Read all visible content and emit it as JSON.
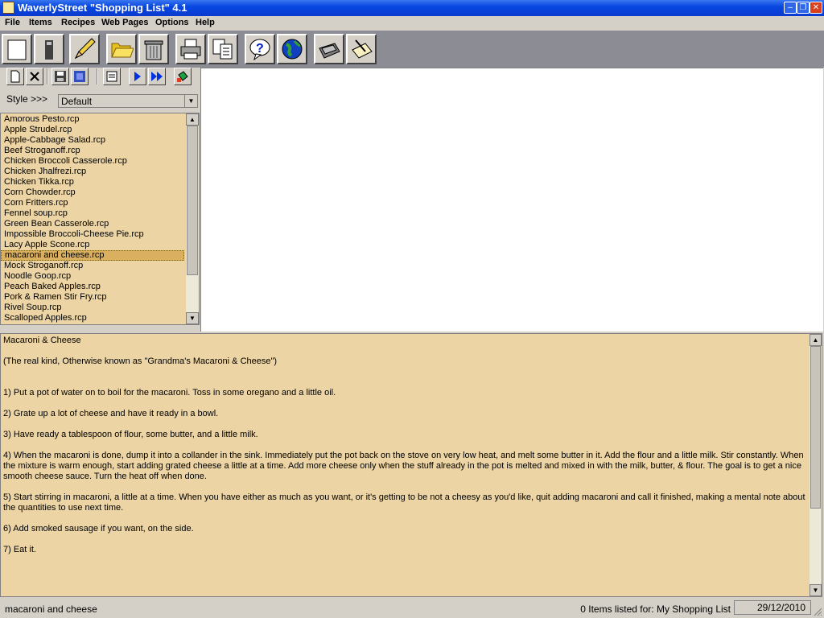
{
  "window": {
    "title": "WaverlyStreet \"Shopping List\" 4.1"
  },
  "menu": [
    "File",
    "Items",
    "Recipes",
    "Web Pages",
    "Options",
    "Help"
  ],
  "toolbar": {
    "large_icons": [
      "new-list-icon",
      "phone-icon",
      "pencil-icon",
      "folder-icon",
      "trash-can-icon",
      "printer-icon",
      "copy-pages-icon",
      "help-icon",
      "globe-icon",
      "fax-icon",
      "notepad-icon"
    ],
    "small_icons": [
      "new-page-icon",
      "delete-x-icon",
      "save-disk-icon",
      "save-list-icon",
      "notes-icon",
      "play-icon",
      "fast-forward-icon",
      "paint-bucket-icon"
    ]
  },
  "style": {
    "label": "Style >>>",
    "value": "Default"
  },
  "recipes": {
    "items": [
      "Amorous Pesto.rcp",
      "Apple Strudel.rcp",
      "Apple-Cabbage Salad.rcp",
      "Beef Stroganoff.rcp",
      "Chicken Broccoli Casserole.rcp",
      "Chicken Jhalfrezi.rcp",
      "Chicken Tikka.rcp",
      "Corn Chowder.rcp",
      "Corn Fritters.rcp",
      "Fennel soup.rcp",
      "Green Bean Casserole.rcp",
      "Impossible Broccoli-Cheese Pie.rcp",
      "Lacy Apple Scone.rcp",
      "macaroni and cheese.rcp",
      "Mock Stroganoff.rcp",
      "Noodle Goop.rcp",
      "Peach Baked Apples.rcp",
      "Pork & Ramen Stir Fry.rcp",
      "Rivel Soup.rcp",
      "Scalloped Apples.rcp"
    ],
    "selected": "macaroni and cheese.rcp"
  },
  "recipe_text": [
    "Macaroni & Cheese",
    "",
    "(The real kind, Otherwise known as \"Grandma's Macaroni & Cheese\")",
    "",
    "",
    "1) Put a pot of water on to boil for the macaroni. Toss in some oregano and a little oil.",
    "",
    "2) Grate up a lot of cheese and have it ready in a bowl.",
    "",
    "3) Have ready a tablespoon of flour, some butter, and a little milk.",
    "",
    "4) When the macaroni is done, dump it into a collander in the sink. Immediately put the pot back on the stove on very low heat, and melt some butter in it. Add the flour and a little milk. Stir constantly. When the mixture is warm enough, start adding grated cheese a little at a time. Add more cheese only when the stuff already in the pot is melted and mixed in with the milk, butter, & flour. The goal is to get a nice smooth cheese sauce. Turn the heat off when done.",
    "",
    "5) Start stirring in macaroni, a little at a time. When you have either as much as you want, or it's getting to be not a cheesy as you'd like, quit adding macaroni and call it finished, making a mental note about the quantities to use next time.",
    "",
    "6) Add smoked sausage if you want, on the side.",
    "",
    "7) Eat it."
  ],
  "status": {
    "current": "macaroni and cheese",
    "count": "0 Items listed for: My Shopping List",
    "date": "29/12/2010"
  },
  "colors": {
    "title_bar": "#0848e0",
    "list_bg": "#ecd4a4",
    "selection": "#dab060",
    "toolbar_bg": "#8c8c94"
  }
}
